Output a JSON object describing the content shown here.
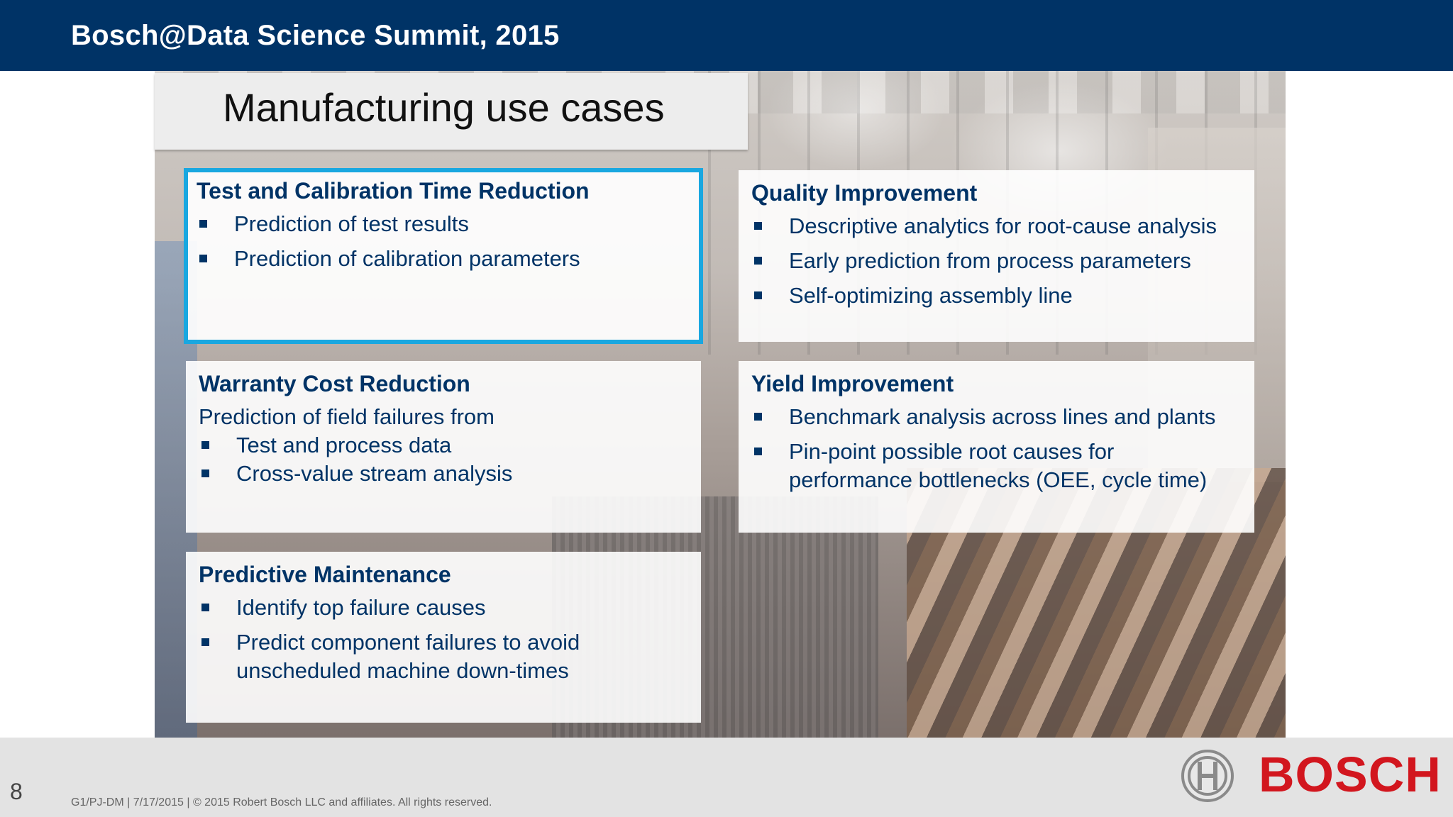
{
  "header": {
    "title": "Bosch@Data Science Summit, 2015"
  },
  "slide": {
    "title": "Manufacturing use cases"
  },
  "cards": {
    "test_calibration": {
      "title": "Test and Calibration Time Reduction",
      "bullets": [
        "Prediction of test results",
        "Prediction of calibration parameters"
      ]
    },
    "quality": {
      "title": "Quality Improvement",
      "bullets": [
        "Descriptive analytics for root-cause analysis",
        "Early prediction from process parameters",
        "Self-optimizing assembly line"
      ]
    },
    "warranty": {
      "title": "Warranty Cost Reduction",
      "intro": "Prediction of field failures from",
      "bullets": [
        "Test and process data",
        "Cross-value stream analysis"
      ]
    },
    "yield": {
      "title": "Yield Improvement",
      "bullets": [
        "Benchmark analysis across lines and plants",
        {
          "line1": "Pin-point possible root causes for",
          "line2": "performance bottlenecks (OEE, cycle time)"
        }
      ]
    },
    "maintenance": {
      "title": "Predictive Maintenance",
      "bullets": [
        "Identify top failure causes",
        {
          "line1": "Predict component failures to avoid",
          "line2": "unscheduled machine down-times"
        }
      ]
    }
  },
  "footer": {
    "page_number": "8",
    "copyright": "G1/PJ-DM | 7/17/2015 | © 2015 Robert Bosch LLC and affiliates. All rights reserved.",
    "brand": "BOSCH"
  },
  "colors": {
    "header_bg": "#003366",
    "text_navy": "#003366",
    "highlight_border": "#19a7e0",
    "brand_red": "#d2161e",
    "footer_bg": "#e3e3e3"
  },
  "icons": {
    "logo": "bosch-armature-logo-icon",
    "bullet": "square-bullet-icon"
  }
}
